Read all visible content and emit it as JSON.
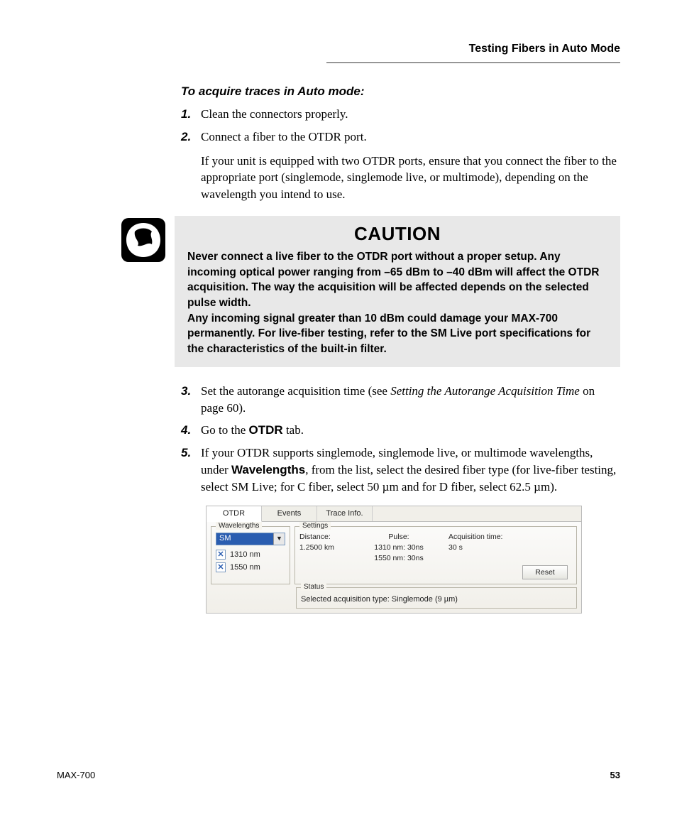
{
  "header": {
    "title": "Testing Fibers in Auto Mode"
  },
  "subhead": "To acquire traces in Auto mode:",
  "steps": {
    "s1": {
      "num": "1.",
      "text": "Clean the connectors properly."
    },
    "s2": {
      "num": "2.",
      "text": "Connect a fiber to the OTDR port.",
      "para": "If your unit is equipped with two OTDR ports, ensure that you connect the fiber to the appropriate port (singlemode, singlemode live, or multimode), depending on the wavelength you intend to use."
    },
    "s3": {
      "num": "3.",
      "pre": "Set the autorange acquisition time (see ",
      "link": "Setting the Autorange Acquisition Time",
      "post": " on page 60)."
    },
    "s4": {
      "num": "4.",
      "pre": "Go to the ",
      "bold": "OTDR",
      "post": " tab."
    },
    "s5": {
      "num": "5.",
      "pre": "If your OTDR supports singlemode, singlemode live, or multimode wavelengths, under ",
      "bold": "Wavelengths",
      "post": ", from the list, select the desired fiber type (for live-fiber testing, select SM Live; for C fiber, select 50 µm and for D fiber, select 62.5 µm)."
    }
  },
  "caution": {
    "title": "CAUTION",
    "p1": "Never connect a live fiber to the OTDR port without a proper setup. Any incoming optical power ranging from –65 dBm to –40 dBm will affect the OTDR acquisition. The way the acquisition will be affected depends on the selected pulse width.",
    "p2": "Any incoming signal greater than 10 dBm could damage your MAX-700 permanently. For live-fiber testing, refer to the SM Live port specifications for the characteristics of the built-in filter."
  },
  "ui": {
    "tabs": {
      "otdr": "OTDR",
      "events": "Events",
      "trace": "Trace Info."
    },
    "wavelengths": {
      "legend": "Wavelengths",
      "selected": "SM",
      "options": [
        "1310 nm",
        "1550 nm"
      ]
    },
    "settings": {
      "legend": "Settings",
      "distance_label": "Distance:",
      "distance_value": "1.2500 km",
      "pulse_label": "Pulse:",
      "pulse1": "1310 nm: 30ns",
      "pulse2": "1550 nm: 30ns",
      "acq_label": "Acquisition time:",
      "acq_value": "30 s",
      "reset": "Reset"
    },
    "status": {
      "legend": "Status",
      "text": "Selected acquisition type: Singlemode (9 µm)"
    }
  },
  "footer": {
    "model": "MAX-700",
    "page": "53"
  }
}
